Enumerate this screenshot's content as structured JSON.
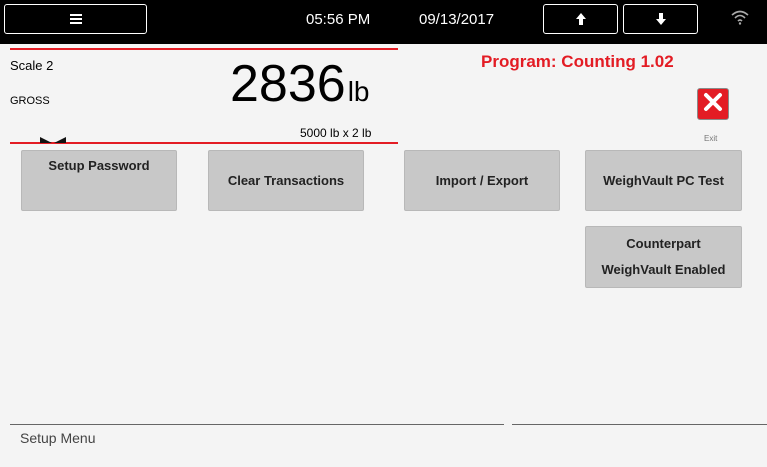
{
  "status_bar": {
    "menu_icon": "hamburger-icon",
    "time": "05:56 PM",
    "date": "09/13/2017",
    "up_icon": "arrow-up-icon",
    "down_icon": "arrow-down-icon",
    "wifi_icon": "wifi-icon"
  },
  "scale": {
    "name": "Scale 2",
    "mode": "GROSS",
    "weight": "2836",
    "unit": "lb",
    "capacity": "5000 lb x 2 lb",
    "center_zero_icon": "center-of-zero-icon"
  },
  "program": {
    "title": "Program: Counting 1.02"
  },
  "exit": {
    "label": "Exit",
    "icon": "close-icon"
  },
  "buttons": {
    "setup_password": "Setup Password",
    "clear_transactions": "Clear Transactions",
    "import_export": "Import / Export",
    "weighvault_pc_test": "WeighVault PC Test",
    "counterpart_line1": "Counterpart",
    "counterpart_line2": "WeighVault Enabled"
  },
  "footer": {
    "title": "Setup Menu"
  },
  "colors": {
    "accent_red": "#e31c24",
    "button_gray": "#c8c8c8",
    "status_bar_black": "#000000"
  }
}
